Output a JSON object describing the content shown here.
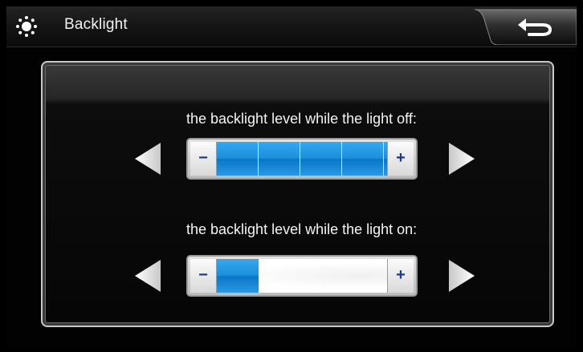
{
  "header": {
    "title": "Backlight",
    "icon": "sun-icon",
    "back_icon": "return-arrow-icon"
  },
  "sliders": [
    {
      "caption": "the backlight level while the light off:",
      "level": 5,
      "max_level": 5,
      "minus_label": "−",
      "plus_label": "+"
    },
    {
      "caption": "the backlight level while the light on:",
      "level": 1,
      "max_level": 5,
      "minus_label": "−",
      "plus_label": "+"
    }
  ],
  "colors": {
    "fill": "#1c8fdc",
    "stepper_text": "#1a3a8c"
  }
}
